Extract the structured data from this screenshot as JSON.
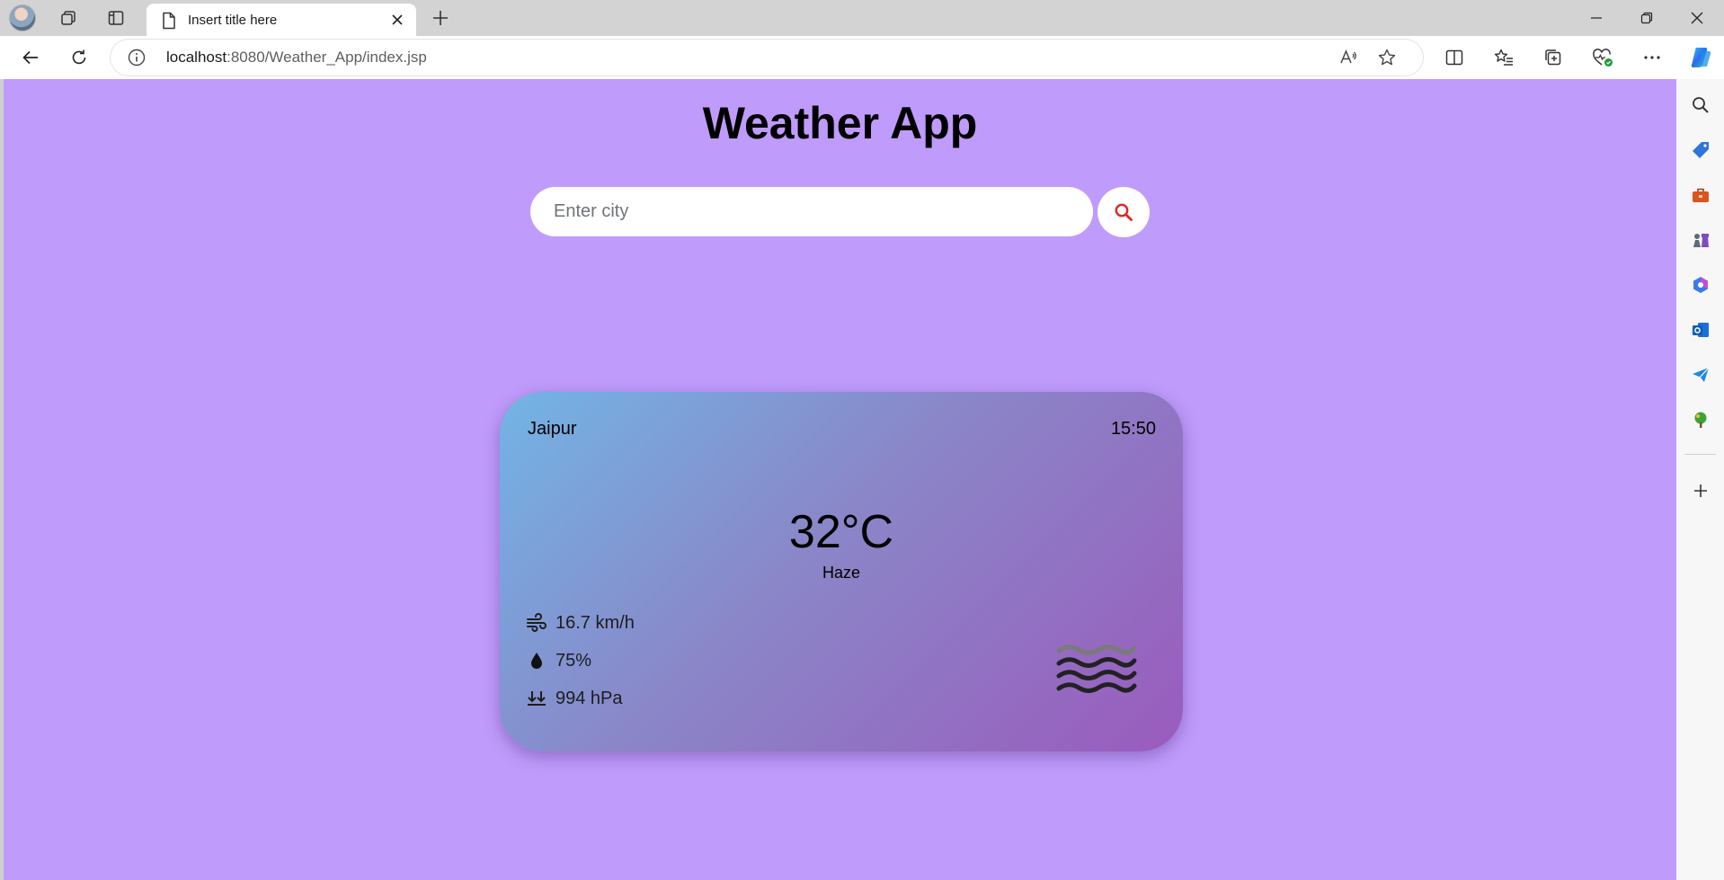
{
  "browser": {
    "tab_title": "Insert title here",
    "url_host": "localhost",
    "url_path": ":8080/Weather_App/index.jsp"
  },
  "page": {
    "title": "Weather App",
    "search": {
      "placeholder": "Enter city",
      "value": ""
    }
  },
  "weather": {
    "city": "Jaipur",
    "time": "15:50",
    "temperature": "32°C",
    "condition": "Haze",
    "wind": "16.7 km/h",
    "humidity": "75%",
    "pressure": "994 hPa"
  },
  "icons": {
    "wind": "wind-icon",
    "humidity": "droplet-icon",
    "pressure": "double-down-arrow-icon",
    "condition": "haze-waves-icon",
    "search": "search-icon"
  },
  "colors": {
    "page_background": "#bf9bfb",
    "card_gradient_start": "#72b5e5",
    "card_gradient_end": "#9a5bbd",
    "search_icon": "#e0261b"
  }
}
